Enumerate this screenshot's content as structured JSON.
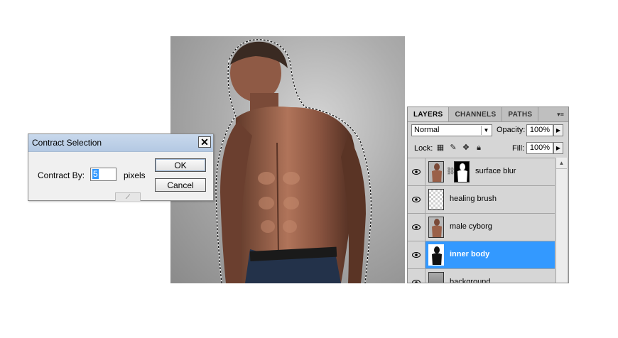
{
  "dialog": {
    "title": "Contract Selection",
    "close": "✕",
    "contract_label": "Contract By:",
    "contract_value": "5",
    "unit": "pixels",
    "ok": "OK",
    "cancel": "Cancel"
  },
  "layers_panel": {
    "tabs": [
      "LAYERS",
      "CHANNELS",
      "PATHS"
    ],
    "blend_mode": "Normal",
    "opacity_label": "Opacity:",
    "opacity": "100%",
    "lock_label": "Lock:",
    "fill_label": "Fill:",
    "fill": "100%",
    "layers": [
      {
        "name": "surface blur",
        "selected": false,
        "has_mask": true
      },
      {
        "name": "healing brush",
        "selected": false,
        "has_mask": false
      },
      {
        "name": "male cyborg",
        "selected": false,
        "has_mask": false
      },
      {
        "name": "inner body",
        "selected": true,
        "has_mask": false
      },
      {
        "name": "background",
        "selected": false,
        "has_mask": false
      }
    ]
  },
  "colors": {
    "selection": "#3399ff",
    "dialog_title": "#b4c9e3"
  }
}
